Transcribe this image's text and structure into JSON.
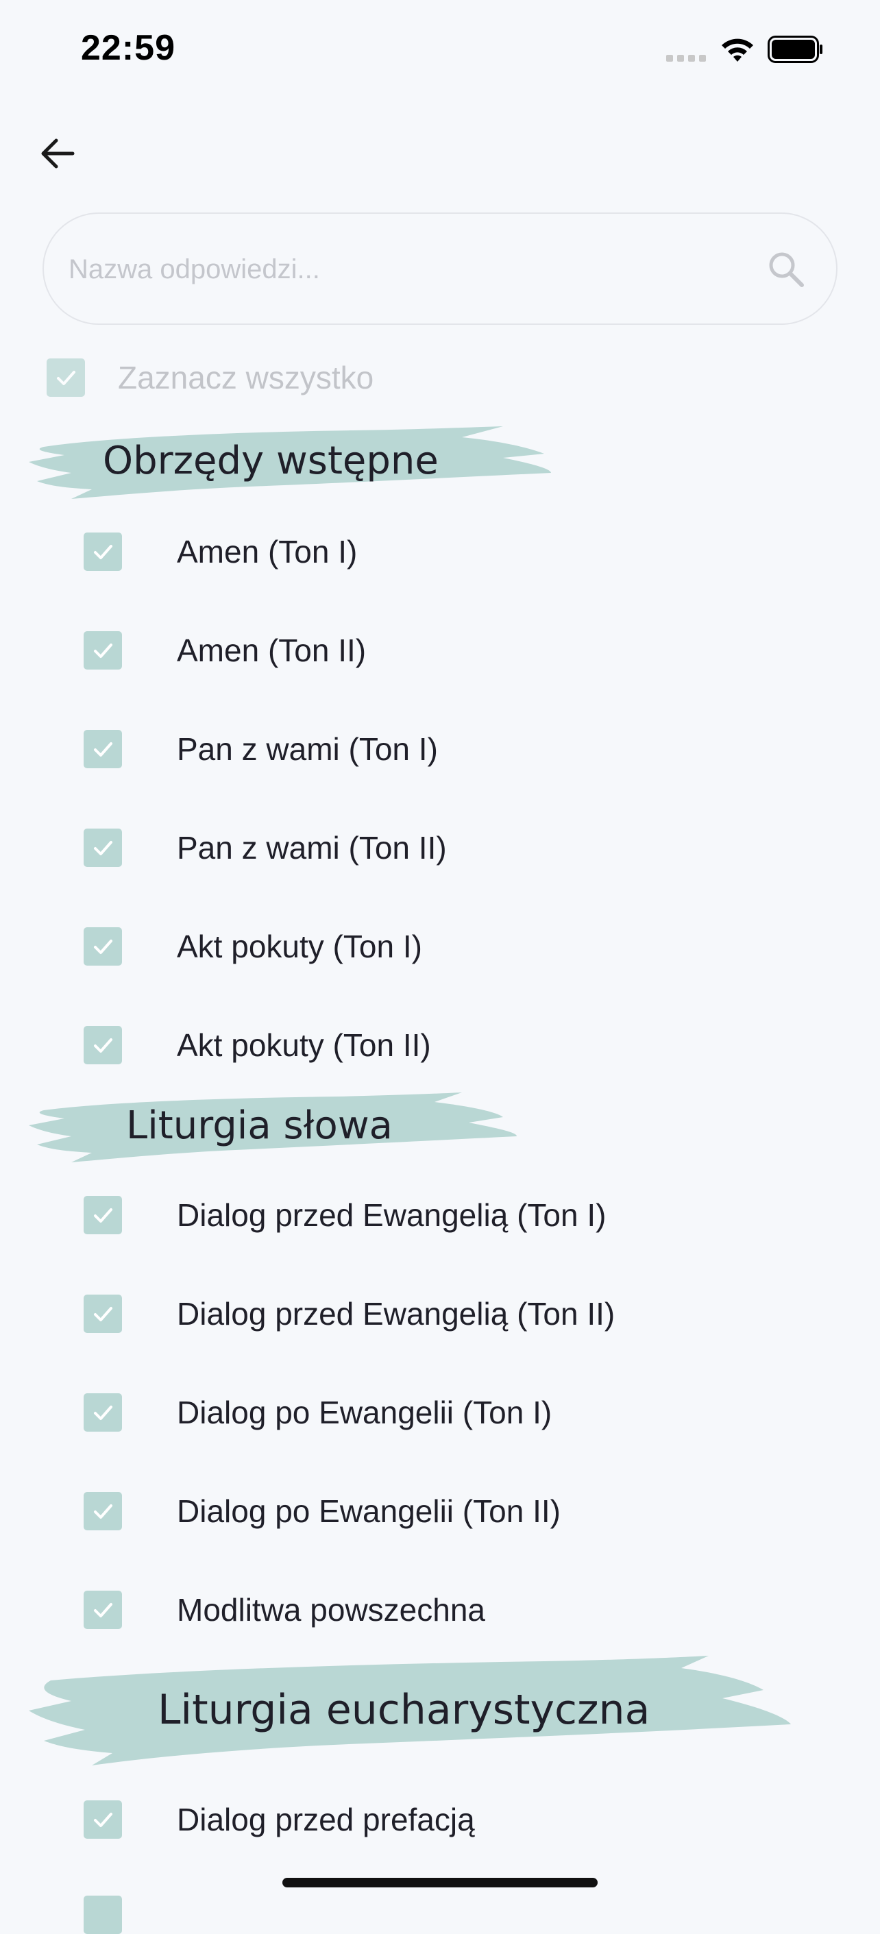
{
  "status_bar": {
    "time": "22:59"
  },
  "icons": {
    "back": "arrow-left-icon",
    "search": "search-icon",
    "check": "check-icon",
    "wifi": "wifi-icon",
    "battery": "battery-icon"
  },
  "colors": {
    "accent": "#b9d7d4",
    "background": "#f6f8fb",
    "text": "#1f1f29",
    "muted": "#c2c4c9"
  },
  "search": {
    "placeholder": "Nazwa odpowiedzi...",
    "value": ""
  },
  "select_all": {
    "label": "Zaznacz wszystko",
    "checked": true
  },
  "sections": [
    {
      "title": "Obrzędy wstępne",
      "items": [
        {
          "label": "Amen (Ton I)",
          "checked": true
        },
        {
          "label": "Amen (Ton II)",
          "checked": true
        },
        {
          "label": "Pan z wami (Ton I)",
          "checked": true
        },
        {
          "label": "Pan z wami (Ton II)",
          "checked": true
        },
        {
          "label": "Akt pokuty (Ton I)",
          "checked": true
        },
        {
          "label": "Akt pokuty (Ton II)",
          "checked": true
        }
      ]
    },
    {
      "title": "Liturgia słowa",
      "items": [
        {
          "label": "Dialog przed Ewangelią (Ton I)",
          "checked": true
        },
        {
          "label": "Dialog przed Ewangelią (Ton II)",
          "checked": true
        },
        {
          "label": "Dialog po Ewangelii (Ton I)",
          "checked": true
        },
        {
          "label": "Dialog po Ewangelii (Ton II)",
          "checked": true
        },
        {
          "label": "Modlitwa powszechna",
          "checked": true
        }
      ]
    },
    {
      "title": "Liturgia eucharystyczna",
      "items": [
        {
          "label": "Dialog przed prefacją",
          "checked": true
        }
      ]
    }
  ]
}
